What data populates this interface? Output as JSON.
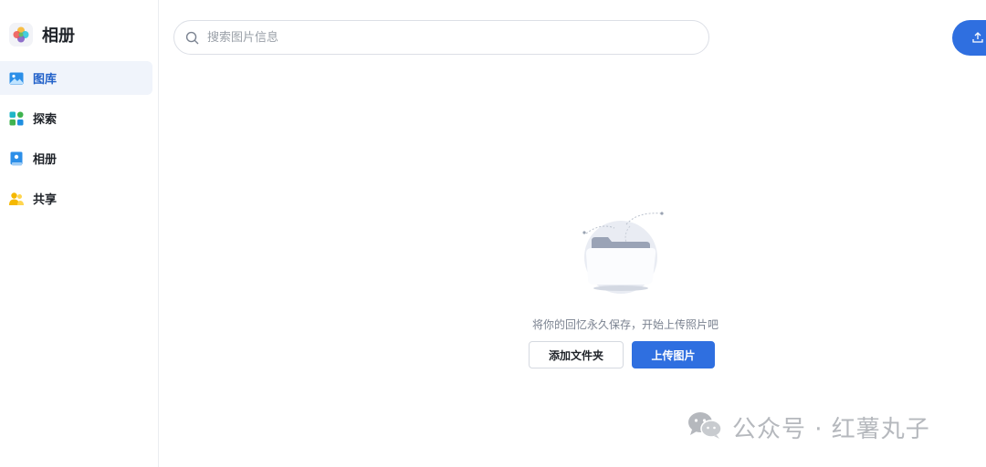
{
  "app": {
    "title": "相册"
  },
  "sidebar": {
    "items": [
      {
        "label": "图库",
        "icon": "image-icon",
        "active": true
      },
      {
        "label": "探索",
        "icon": "explore-grid-icon",
        "active": false
      },
      {
        "label": "相册",
        "icon": "album-icon",
        "active": false
      },
      {
        "label": "共享",
        "icon": "share-users-icon",
        "active": false
      }
    ]
  },
  "search": {
    "placeholder": "搜索图片信息"
  },
  "empty_state": {
    "message": "将你的回忆永久保存，开始上传照片吧",
    "add_folder_label": "添加文件夹",
    "upload_label": "上传图片"
  },
  "watermark": {
    "text": "公众号 · 红薯丸子"
  },
  "colors": {
    "accent": "#2f6fe0",
    "active_bg": "#f0f4fb",
    "active_text": "#1f5fc8"
  }
}
